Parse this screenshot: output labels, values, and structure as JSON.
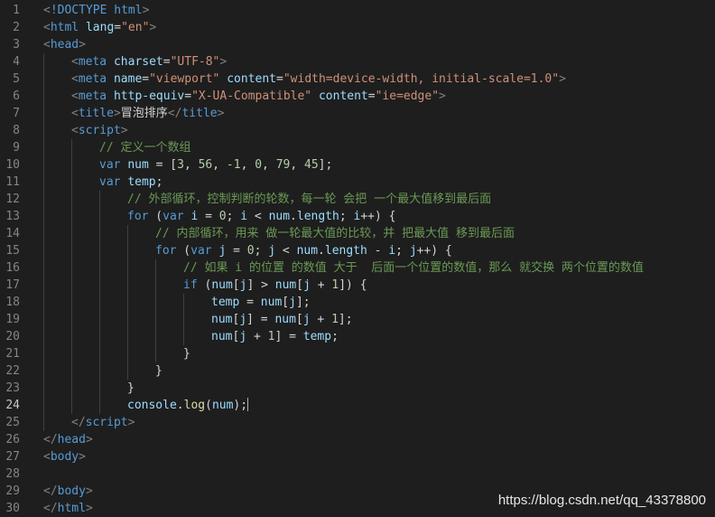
{
  "editor": {
    "lines": [
      {
        "n": "1",
        "indent": 0,
        "tokens": [
          [
            "t-punct",
            "<"
          ],
          [
            "t-tag",
            "!DOCTYPE html"
          ],
          [
            "t-punct",
            ">"
          ]
        ]
      },
      {
        "n": "2",
        "indent": 0,
        "tokens": [
          [
            "t-punct",
            "<"
          ],
          [
            "t-tag",
            "html "
          ],
          [
            "t-attr",
            "lang"
          ],
          [
            "t-plain",
            "="
          ],
          [
            "t-str",
            "\"en\""
          ],
          [
            "t-punct",
            ">"
          ]
        ]
      },
      {
        "n": "3",
        "indent": 0,
        "tokens": [
          [
            "t-punct",
            "<"
          ],
          [
            "t-tag",
            "head"
          ],
          [
            "t-punct",
            ">"
          ]
        ]
      },
      {
        "n": "4",
        "indent": 1,
        "tokens": [
          [
            "t-punct",
            "<"
          ],
          [
            "t-tag",
            "meta "
          ],
          [
            "t-attr",
            "charset"
          ],
          [
            "t-plain",
            "="
          ],
          [
            "t-str",
            "\"UTF-8\""
          ],
          [
            "t-punct",
            ">"
          ]
        ]
      },
      {
        "n": "5",
        "indent": 1,
        "tokens": [
          [
            "t-punct",
            "<"
          ],
          [
            "t-tag",
            "meta "
          ],
          [
            "t-attr",
            "name"
          ],
          [
            "t-plain",
            "="
          ],
          [
            "t-str",
            "\"viewport\""
          ],
          [
            "t-plain",
            " "
          ],
          [
            "t-attr",
            "content"
          ],
          [
            "t-plain",
            "="
          ],
          [
            "t-str",
            "\"width=device-width, initial-scale=1.0\""
          ],
          [
            "t-punct",
            ">"
          ]
        ]
      },
      {
        "n": "6",
        "indent": 1,
        "tokens": [
          [
            "t-punct",
            "<"
          ],
          [
            "t-tag",
            "meta "
          ],
          [
            "t-attr",
            "http-equiv"
          ],
          [
            "t-plain",
            "="
          ],
          [
            "t-str",
            "\"X-UA-Compatible\""
          ],
          [
            "t-plain",
            " "
          ],
          [
            "t-attr",
            "content"
          ],
          [
            "t-plain",
            "="
          ],
          [
            "t-str",
            "\"ie=edge\""
          ],
          [
            "t-punct",
            ">"
          ]
        ]
      },
      {
        "n": "7",
        "indent": 1,
        "tokens": [
          [
            "t-punct",
            "<"
          ],
          [
            "t-tag",
            "title"
          ],
          [
            "t-punct",
            ">"
          ],
          [
            "t-plain",
            "冒泡排序"
          ],
          [
            "t-punct",
            "</"
          ],
          [
            "t-tag",
            "title"
          ],
          [
            "t-punct",
            ">"
          ]
        ]
      },
      {
        "n": "8",
        "indent": 1,
        "tokens": [
          [
            "t-punct",
            "<"
          ],
          [
            "t-tag",
            "script"
          ],
          [
            "t-punct",
            ">"
          ]
        ]
      },
      {
        "n": "9",
        "indent": 2,
        "tokens": [
          [
            "t-cmt",
            "// 定义一个数组"
          ]
        ]
      },
      {
        "n": "10",
        "indent": 2,
        "tokens": [
          [
            "t-kw",
            "var "
          ],
          [
            "t-var",
            "num"
          ],
          [
            "t-plain",
            " = ["
          ],
          [
            "t-num",
            "3"
          ],
          [
            "t-plain",
            ", "
          ],
          [
            "t-num",
            "56"
          ],
          [
            "t-plain",
            ", "
          ],
          [
            "t-num",
            "-1"
          ],
          [
            "t-plain",
            ", "
          ],
          [
            "t-num",
            "0"
          ],
          [
            "t-plain",
            ", "
          ],
          [
            "t-num",
            "79"
          ],
          [
            "t-plain",
            ", "
          ],
          [
            "t-num",
            "45"
          ],
          [
            "t-plain",
            "];"
          ]
        ]
      },
      {
        "n": "11",
        "indent": 2,
        "tokens": [
          [
            "t-kw",
            "var "
          ],
          [
            "t-var",
            "temp"
          ],
          [
            "t-plain",
            ";"
          ]
        ]
      },
      {
        "n": "12",
        "indent": 3,
        "tokens": [
          [
            "t-cmt",
            "// 外部循环，控制判断的轮数，每一轮 会把 一个最大值移到最后面"
          ]
        ]
      },
      {
        "n": "13",
        "indent": 3,
        "tokens": [
          [
            "t-kw",
            "for"
          ],
          [
            "t-plain",
            " ("
          ],
          [
            "t-kw",
            "var "
          ],
          [
            "t-var",
            "i"
          ],
          [
            "t-plain",
            " = "
          ],
          [
            "t-num",
            "0"
          ],
          [
            "t-plain",
            "; "
          ],
          [
            "t-var",
            "i"
          ],
          [
            "t-plain",
            " < "
          ],
          [
            "t-var",
            "num"
          ],
          [
            "t-plain",
            "."
          ],
          [
            "t-var",
            "length"
          ],
          [
            "t-plain",
            "; "
          ],
          [
            "t-var",
            "i"
          ],
          [
            "t-plain",
            "++) {"
          ]
        ]
      },
      {
        "n": "14",
        "indent": 4,
        "tokens": [
          [
            "t-cmt",
            "// 内部循环，用来 做一轮最大值的比较，并 把最大值 移到最后面"
          ]
        ]
      },
      {
        "n": "15",
        "indent": 4,
        "tokens": [
          [
            "t-kw",
            "for"
          ],
          [
            "t-plain",
            " ("
          ],
          [
            "t-kw",
            "var "
          ],
          [
            "t-var",
            "j"
          ],
          [
            "t-plain",
            " = "
          ],
          [
            "t-num",
            "0"
          ],
          [
            "t-plain",
            "; "
          ],
          [
            "t-var",
            "j"
          ],
          [
            "t-plain",
            " < "
          ],
          [
            "t-var",
            "num"
          ],
          [
            "t-plain",
            "."
          ],
          [
            "t-var",
            "length"
          ],
          [
            "t-plain",
            " - "
          ],
          [
            "t-var",
            "i"
          ],
          [
            "t-plain",
            "; "
          ],
          [
            "t-var",
            "j"
          ],
          [
            "t-plain",
            "++) {"
          ]
        ]
      },
      {
        "n": "16",
        "indent": 5,
        "tokens": [
          [
            "t-cmt",
            "// 如果 i 的位置 的数值 大于  后面一个位置的数值，那么 就交换 两个位置的数值"
          ]
        ]
      },
      {
        "n": "17",
        "indent": 5,
        "tokens": [
          [
            "t-kw",
            "if"
          ],
          [
            "t-plain",
            " ("
          ],
          [
            "t-var",
            "num"
          ],
          [
            "t-plain",
            "["
          ],
          [
            "t-var",
            "j"
          ],
          [
            "t-plain",
            "] > "
          ],
          [
            "t-var",
            "num"
          ],
          [
            "t-plain",
            "["
          ],
          [
            "t-var",
            "j"
          ],
          [
            "t-plain",
            " + "
          ],
          [
            "t-num",
            "1"
          ],
          [
            "t-plain",
            "]) {"
          ]
        ]
      },
      {
        "n": "18",
        "indent": 6,
        "tokens": [
          [
            "t-var",
            "temp"
          ],
          [
            "t-plain",
            " = "
          ],
          [
            "t-var",
            "num"
          ],
          [
            "t-plain",
            "["
          ],
          [
            "t-var",
            "j"
          ],
          [
            "t-plain",
            "];"
          ]
        ]
      },
      {
        "n": "19",
        "indent": 6,
        "tokens": [
          [
            "t-var",
            "num"
          ],
          [
            "t-plain",
            "["
          ],
          [
            "t-var",
            "j"
          ],
          [
            "t-plain",
            "] = "
          ],
          [
            "t-var",
            "num"
          ],
          [
            "t-plain",
            "["
          ],
          [
            "t-var",
            "j"
          ],
          [
            "t-plain",
            " + "
          ],
          [
            "t-num",
            "1"
          ],
          [
            "t-plain",
            "];"
          ]
        ]
      },
      {
        "n": "20",
        "indent": 6,
        "tokens": [
          [
            "t-var",
            "num"
          ],
          [
            "t-plain",
            "["
          ],
          [
            "t-var",
            "j"
          ],
          [
            "t-plain",
            " + "
          ],
          [
            "t-num",
            "1"
          ],
          [
            "t-plain",
            "] = "
          ],
          [
            "t-var",
            "temp"
          ],
          [
            "t-plain",
            ";"
          ]
        ]
      },
      {
        "n": "21",
        "indent": 5,
        "tokens": [
          [
            "t-plain",
            "}"
          ]
        ]
      },
      {
        "n": "22",
        "indent": 4,
        "tokens": [
          [
            "t-plain",
            "}"
          ]
        ]
      },
      {
        "n": "23",
        "indent": 3,
        "tokens": [
          [
            "t-plain",
            "}"
          ]
        ]
      },
      {
        "n": "24",
        "indent": 3,
        "current": true,
        "tokens": [
          [
            "t-var",
            "console"
          ],
          [
            "t-plain",
            "."
          ],
          [
            "t-fn",
            "log"
          ],
          [
            "t-plain",
            "("
          ],
          [
            "t-var",
            "num"
          ],
          [
            "t-plain",
            ");"
          ]
        ]
      },
      {
        "n": "25",
        "indent": 1,
        "tokens": [
          [
            "t-punct",
            "</"
          ],
          [
            "t-tag",
            "script"
          ],
          [
            "t-punct",
            ">"
          ]
        ]
      },
      {
        "n": "26",
        "indent": 0,
        "tokens": [
          [
            "t-punct",
            "</"
          ],
          [
            "t-tag",
            "head"
          ],
          [
            "t-punct",
            ">"
          ]
        ]
      },
      {
        "n": "27",
        "indent": 0,
        "tokens": [
          [
            "t-punct",
            "<"
          ],
          [
            "t-tag",
            "body"
          ],
          [
            "t-punct",
            ">"
          ]
        ]
      },
      {
        "n": "28",
        "indent": 0,
        "tokens": []
      },
      {
        "n": "29",
        "indent": 0,
        "tokens": [
          [
            "t-punct",
            "</"
          ],
          [
            "t-tag",
            "body"
          ],
          [
            "t-punct",
            ">"
          ]
        ]
      },
      {
        "n": "30",
        "indent": 0,
        "tokens": [
          [
            "t-punct",
            "</"
          ],
          [
            "t-tag",
            "html"
          ],
          [
            "t-punct",
            ">"
          ]
        ]
      }
    ]
  },
  "watermark": "https://blog.csdn.net/qq_43378800"
}
